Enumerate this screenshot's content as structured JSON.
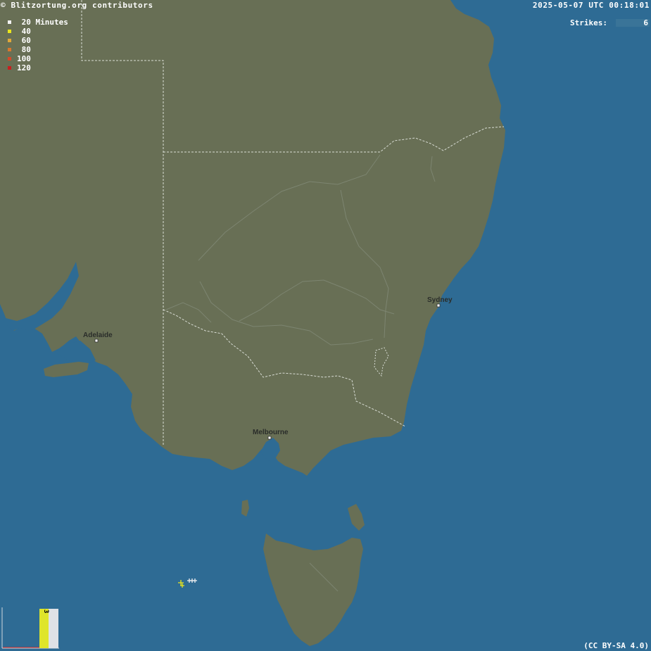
{
  "header": {
    "copyright": "© Blitzortung.org contributors",
    "timestamp": "2025-05-07 UTC 00:18:01"
  },
  "strikes": {
    "label": "Strikes:",
    "value": "6"
  },
  "legend": {
    "items": [
      {
        "label": " 20 Minutes",
        "color": "#f2f2f2"
      },
      {
        "label": " 40",
        "color": "#e9e51c"
      },
      {
        "label": " 60",
        "color": "#e0a83a"
      },
      {
        "label": " 80",
        "color": "#d8782e"
      },
      {
        "label": "100",
        "color": "#d44a2a"
      },
      {
        "label": "120",
        "color": "#c81e1e"
      }
    ]
  },
  "cities": [
    {
      "name": "Adelaide"
    },
    {
      "name": "Sydney"
    },
    {
      "name": "Melbourne"
    }
  ],
  "histogram": {
    "count": "3",
    "bar_color": "#dfe52a"
  },
  "license": "(CC BY-SA 4.0)",
  "colors": {
    "ocean": "#2e6b94",
    "land": "#686f55",
    "border": "#d8dcd4",
    "river": "#7d8571",
    "strike_recent": "#f2f2f2",
    "strike_40": "#e9e51c"
  }
}
